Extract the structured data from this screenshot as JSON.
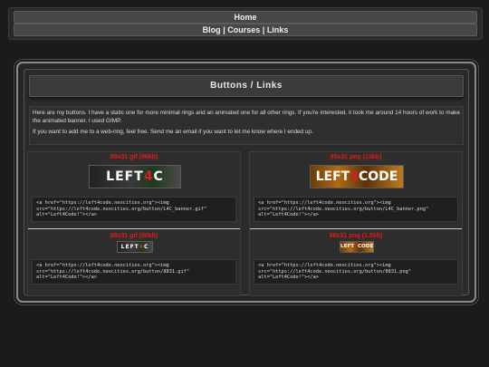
{
  "nav": {
    "home": "Home",
    "blog": "Blog",
    "courses": "Courses",
    "links": "Links",
    "separator": "|"
  },
  "page": {
    "title": "Buttons / Links",
    "intro_1": "Here are my buttons. I have a static one for more minimal rings and an animated one for all other rings. If you're interested, it took me around 14 hours of work to make the animated banner. I used GIMP.",
    "intro_2": "If you want to add me to a web-ring, feel free. Send me an email if you want to let me know where I ended up."
  },
  "buttons": [
    {
      "caption": "88x31 gif (96kb)",
      "banner_left": "LEFT",
      "banner_four": "4",
      "banner_right": "C",
      "code": "<a href=\"https://left4code.neocities.org\"><img src=\"https://left4code.neocities.org/button/L4C_banner.gif\" alt=\"Left4Code!\"></a>"
    },
    {
      "caption": "88x31 png (13kb)",
      "banner_left": "LEFT",
      "banner_four": "4",
      "banner_right": "CODE",
      "code": "<a href=\"https://left4code.neocities.org\"><img src=\"https://left4code.neocities.org/button/L4C_banner.png\" alt=\"Left4Code!\"></a>"
    },
    {
      "caption": "88x31 gif (80kb)",
      "banner_left": "LEFT",
      "banner_four": "4",
      "banner_right": "C",
      "code": "<a href=\"https://left4code.neocities.org\"><img src=\"https://left4code.neocities.org/button/8831.gif\" alt=\"Left4Code!\"></a>"
    },
    {
      "caption": "88x31 png (1.5kb)",
      "banner_left": "LEFT",
      "banner_four": "4",
      "banner_right": "CODE",
      "code": "<a href=\"https://left4code.neocities.org\"><img src=\"https://left4code.neocities.org/button/8831.png\" alt=\"Left4Code!\"></a>"
    }
  ]
}
